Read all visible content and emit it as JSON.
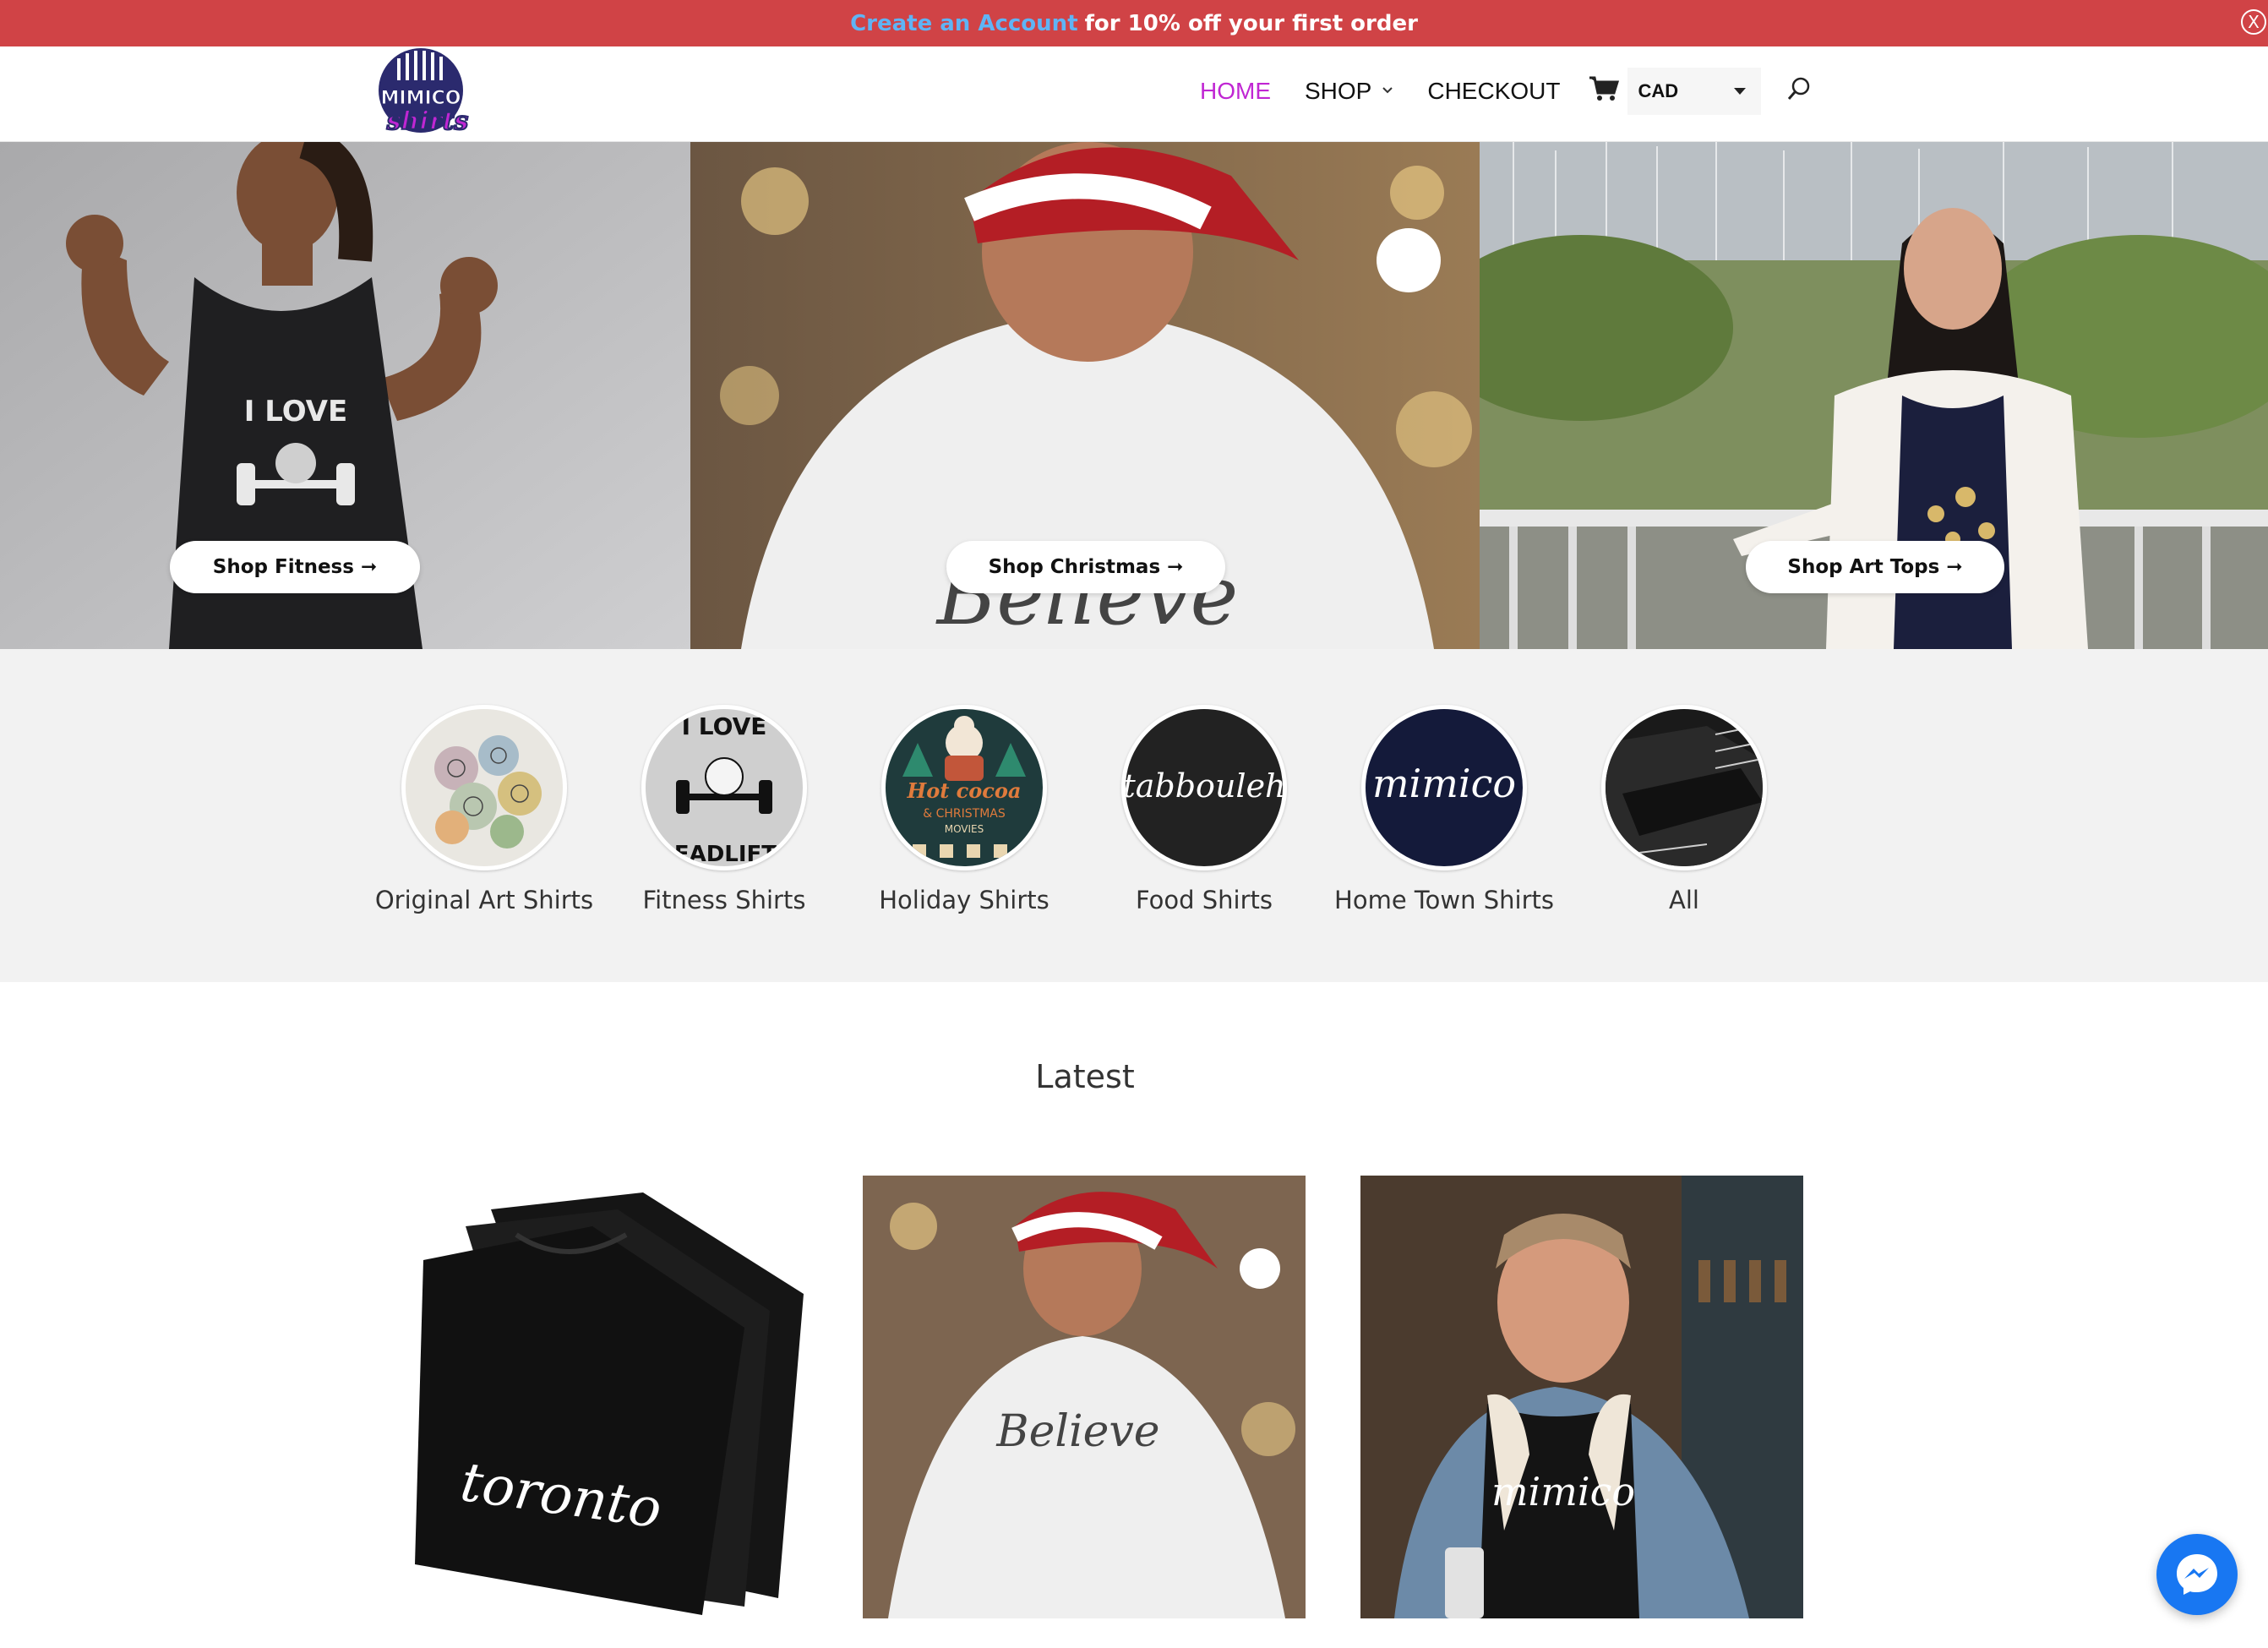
{
  "promo": {
    "link_text": "Create an Account",
    "text": "for 10% off your first order",
    "close_label": "X",
    "link_color": "#5fb4f5",
    "bg_color": "#d04346"
  },
  "logo": {
    "line1": "MIMICO",
    "line2": "shirts"
  },
  "nav": {
    "home": "HOME",
    "shop": "SHOP",
    "checkout": "CHECKOUT",
    "currency": "CAD",
    "active_color": "#c026d3",
    "cart_icon": "cart-icon",
    "search_icon": "search-icon"
  },
  "hero": [
    {
      "button": "Shop Fitness ➞",
      "shirt_text": "I LOVE"
    },
    {
      "button": "Shop Christmas ➞",
      "shirt_text": "Believe"
    },
    {
      "button": "Shop Art Tops ➞"
    }
  ],
  "categories": [
    {
      "label": "Original Art Shirts"
    },
    {
      "label": "Fitness Shirts",
      "img_text_1": "I LOVE",
      "img_text_2": "DEADLIFTS"
    },
    {
      "label": "Holiday Shirts",
      "img_text_1": "Hot cocoa",
      "img_text_2": "& CHRISTMAS",
      "img_text_3": "MOVIES"
    },
    {
      "label": "Food Shirts",
      "img_text": "tabbouleh"
    },
    {
      "label": "Home Town Shirts",
      "img_text": "mimico"
    },
    {
      "label": "All"
    }
  ],
  "latest": {
    "title": "Latest",
    "products": [
      {
        "img_text": "toronto"
      },
      {
        "img_text": "Believe"
      },
      {
        "img_text": "mimico"
      }
    ]
  },
  "messenger_icon": "messenger-icon"
}
